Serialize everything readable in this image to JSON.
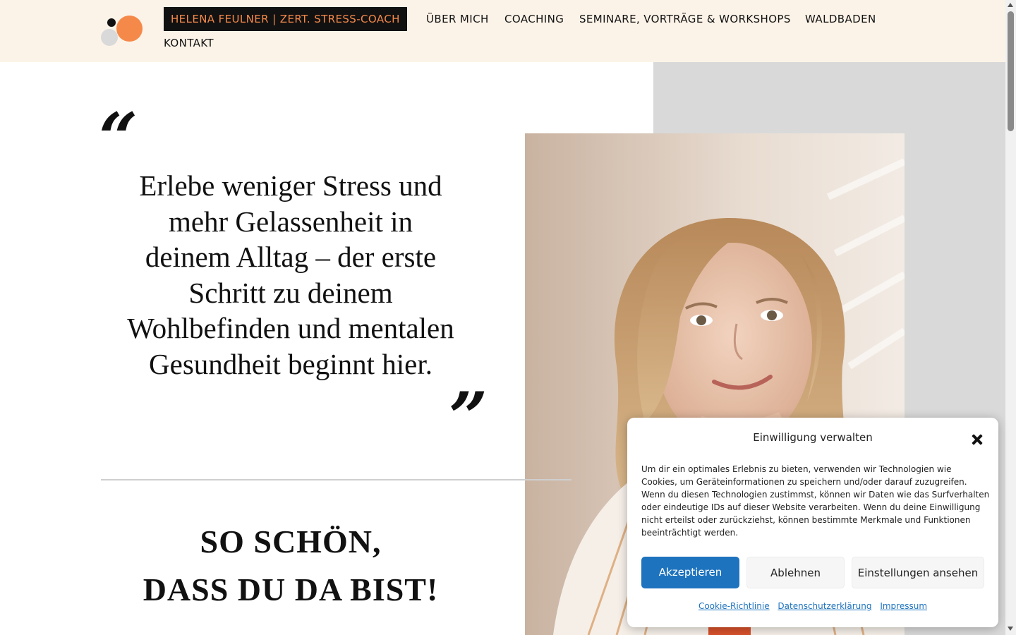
{
  "header": {
    "brand": "HELENA FEULNER | ZERT. STRESS-COACH",
    "nav": [
      "ÜBER MICH",
      "COACHING",
      "SEMINARE, VORTRÄGE & WORKSHOPS",
      "WALDBADEN",
      "KONTAKT"
    ]
  },
  "hero": {
    "quote": "Erlebe weniger Stress und mehr Gelassenheit in deinem Alltag – der erste Schritt zu deinem Wohlbefinden und mentalen Gesundheit beginnt hier.",
    "welcome_line1": "SO SCHÖN,",
    "welcome_line2": "DASS DU DA BIST!"
  },
  "cookie": {
    "title": "Einwilligung verwalten",
    "body": "Um dir ein optimales Erlebnis zu bieten, verwenden wir Technologien wie Cookies, um Geräteinformationen zu speichern und/oder darauf zuzugreifen. Wenn du diesen Technologien zustimmst, können wir Daten wie das Surfverhalten oder eindeutige IDs auf dieser Website verarbeiten. Wenn du deine Einwilligung nicht erteilst oder zurückziehst, können bestimmte Merkmale und Funktionen beeinträchtigt werden.",
    "accept": "Akzeptieren",
    "deny": "Ablehnen",
    "settings": "Einstellungen ansehen",
    "links": [
      "Cookie-Richtlinie",
      "Datenschutzerklärung",
      "Impressum"
    ]
  },
  "colors": {
    "header_bg": "#fcf3e8",
    "accent_orange": "#f5894a",
    "brand_bg": "#111111",
    "button_blue": "#1e73be",
    "grey_block": "#d9d9d9"
  }
}
